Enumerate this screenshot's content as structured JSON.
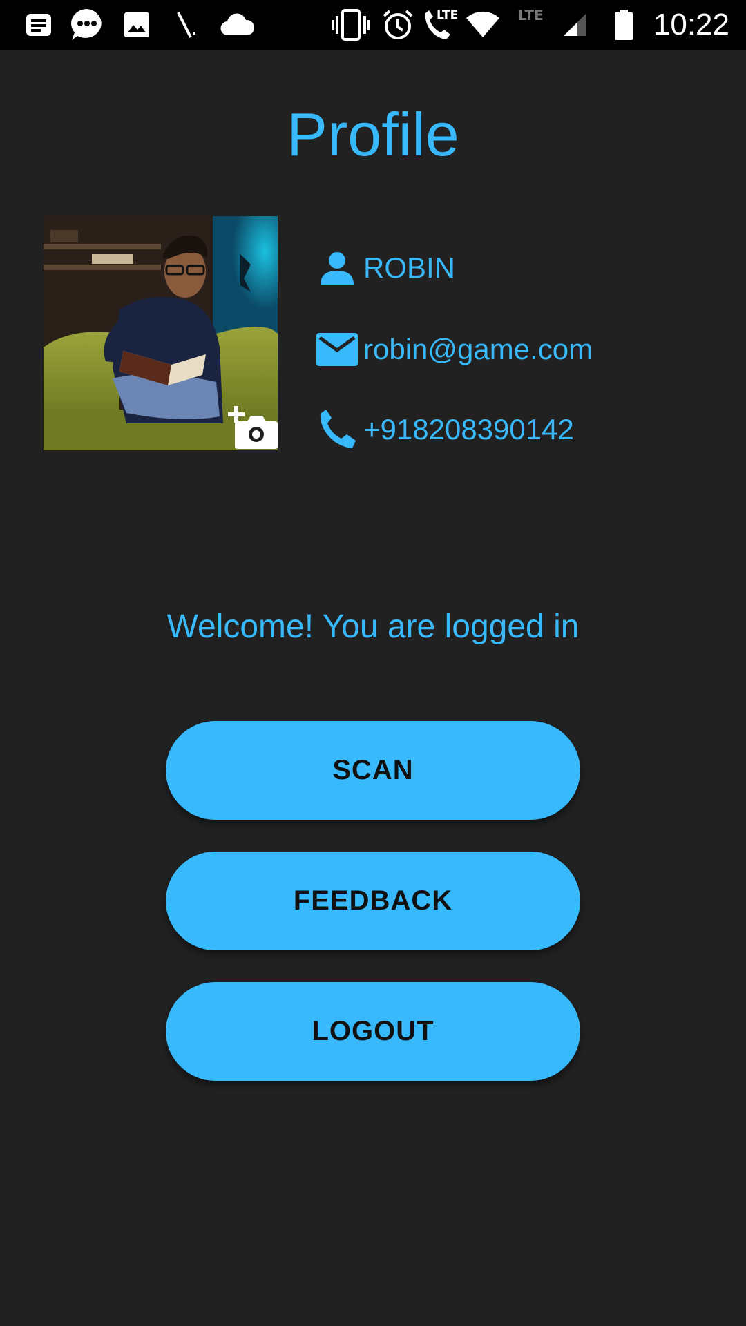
{
  "status_bar": {
    "time": "10:22",
    "lte_label": "LTE",
    "left_icons": [
      "notes-icon",
      "messages-icon",
      "gallery-icon",
      "wand-icon",
      "cloud-icon"
    ],
    "right_icons": [
      "vibrate-icon",
      "alarm-icon",
      "volte-call-icon",
      "wifi-icon",
      "lte-icon",
      "signal-icon",
      "battery-icon"
    ]
  },
  "profile": {
    "title": "Profile",
    "name": "ROBIN",
    "email": "robin@game.com",
    "phone": "+918208390142"
  },
  "welcome_message": "Welcome! You are logged in",
  "buttons": {
    "scan": "SCAN",
    "feedback": "FEEDBACK",
    "logout": "LOGOUT"
  },
  "colors": {
    "accent": "#38b9fc",
    "background": "#212121",
    "status_bar": "#000000",
    "button_text": "#111111"
  }
}
